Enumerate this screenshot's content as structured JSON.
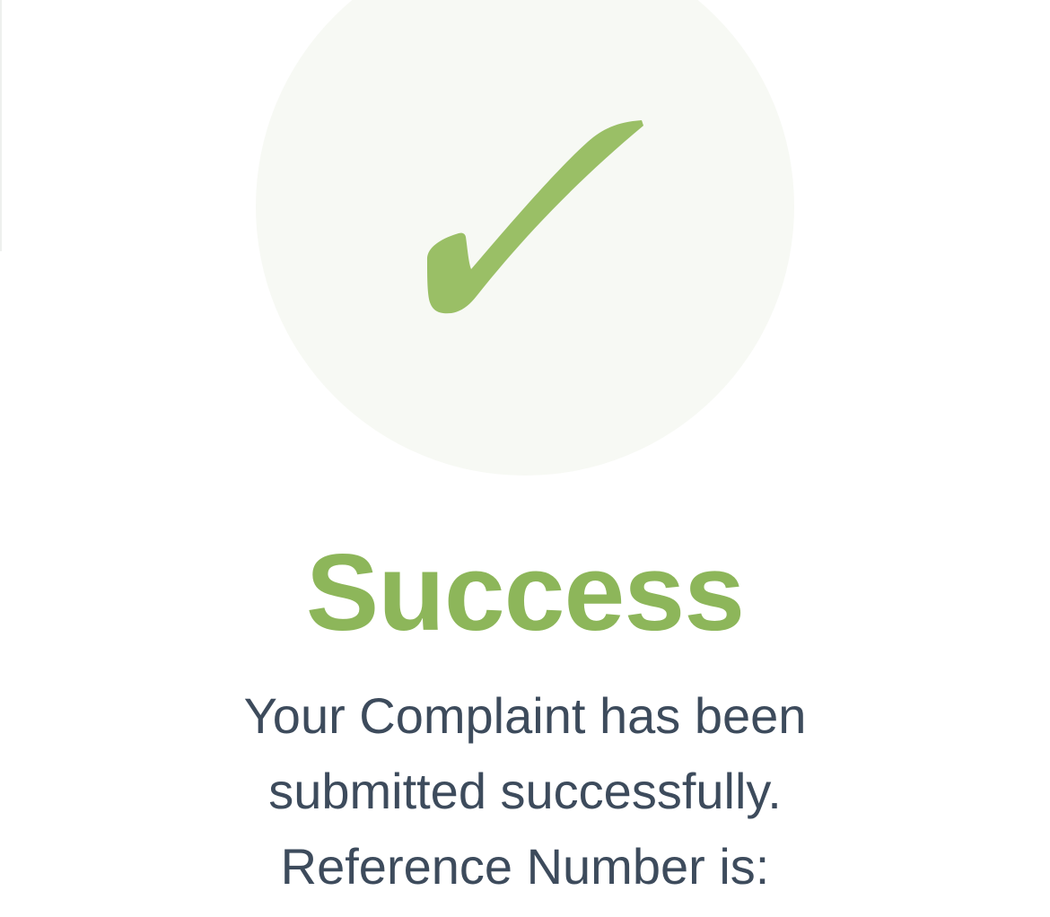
{
  "status": {
    "icon": "checkmark-icon",
    "title": "Success",
    "message_lines": [
      "Your Complaint has been",
      "submitted successfully.",
      "Reference Number is:"
    ]
  },
  "colors": {
    "accent": "#8db65a",
    "circle_bg": "#f7f9f4",
    "text": "#3d4b5c"
  }
}
